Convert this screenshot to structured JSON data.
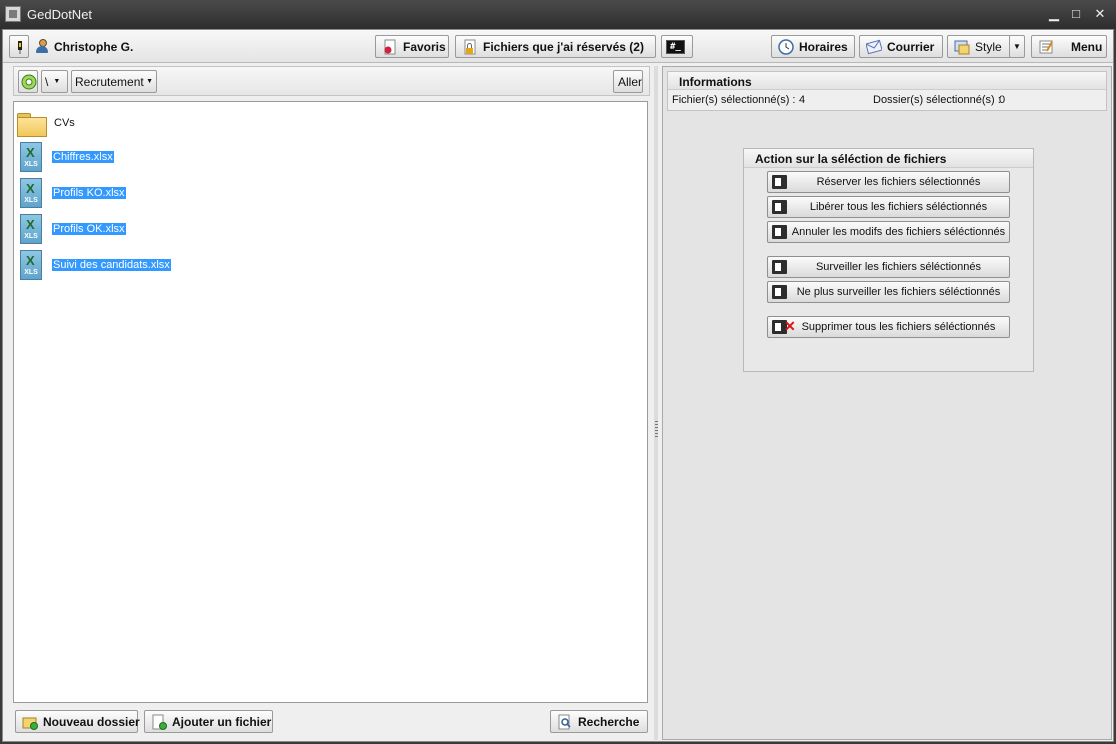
{
  "window": {
    "title": "GedDotNet",
    "controls": {
      "minimize": "▁",
      "maximize": "□",
      "close": "✕"
    }
  },
  "toolbar": {
    "user_name": "Christophe G.",
    "favoris": "Favoris",
    "reserved_files": "Fichiers que j'ai réservés (2)",
    "console": "#_",
    "horaires": "Horaires",
    "courrier": "Courrier",
    "style": "Style",
    "menu": "Menu"
  },
  "pathbar": {
    "separator": "\\",
    "folder": "Recrutement",
    "go_button": "Aller"
  },
  "files": [
    {
      "name": "CVs",
      "type": "folder",
      "selected": false
    },
    {
      "name": "Chiffres.xlsx",
      "type": "xls",
      "selected": true
    },
    {
      "name": "Profils KO.xlsx",
      "type": "xls",
      "selected": true
    },
    {
      "name": "Profils OK.xlsx",
      "type": "xls",
      "selected": true
    },
    {
      "name": "Suivi des candidats.xlsx",
      "type": "xls",
      "selected": true
    }
  ],
  "file_icon_tag": "XLS",
  "bottom": {
    "new_folder": "Nouveau dossier",
    "add_file": "Ajouter un fichier",
    "search": "Recherche"
  },
  "info": {
    "title": "Informations",
    "files_selected_label": "Fichier(s) sélectionné(s) :",
    "files_selected_value": "4",
    "folders_selected_label": "Dossier(s) sélectionné(s) :",
    "folders_selected_value": "0"
  },
  "actions": {
    "title": "Action sur la séléction de fichiers",
    "reserve": "Réserver les fichiers sélectionnés",
    "release": "Libérer tous les fichiers séléctionnés",
    "cancel": "Annuler les modifs des fichiers séléctionnés",
    "watch": "Surveiller les fichiers séléctionnés",
    "unwatch": "Ne plus surveiller les fichiers séléctionnés",
    "delete": "Supprimer tous les fichiers séléctionnés"
  },
  "colors": {
    "selection": "#3399ff",
    "titlebar": "#333333"
  }
}
